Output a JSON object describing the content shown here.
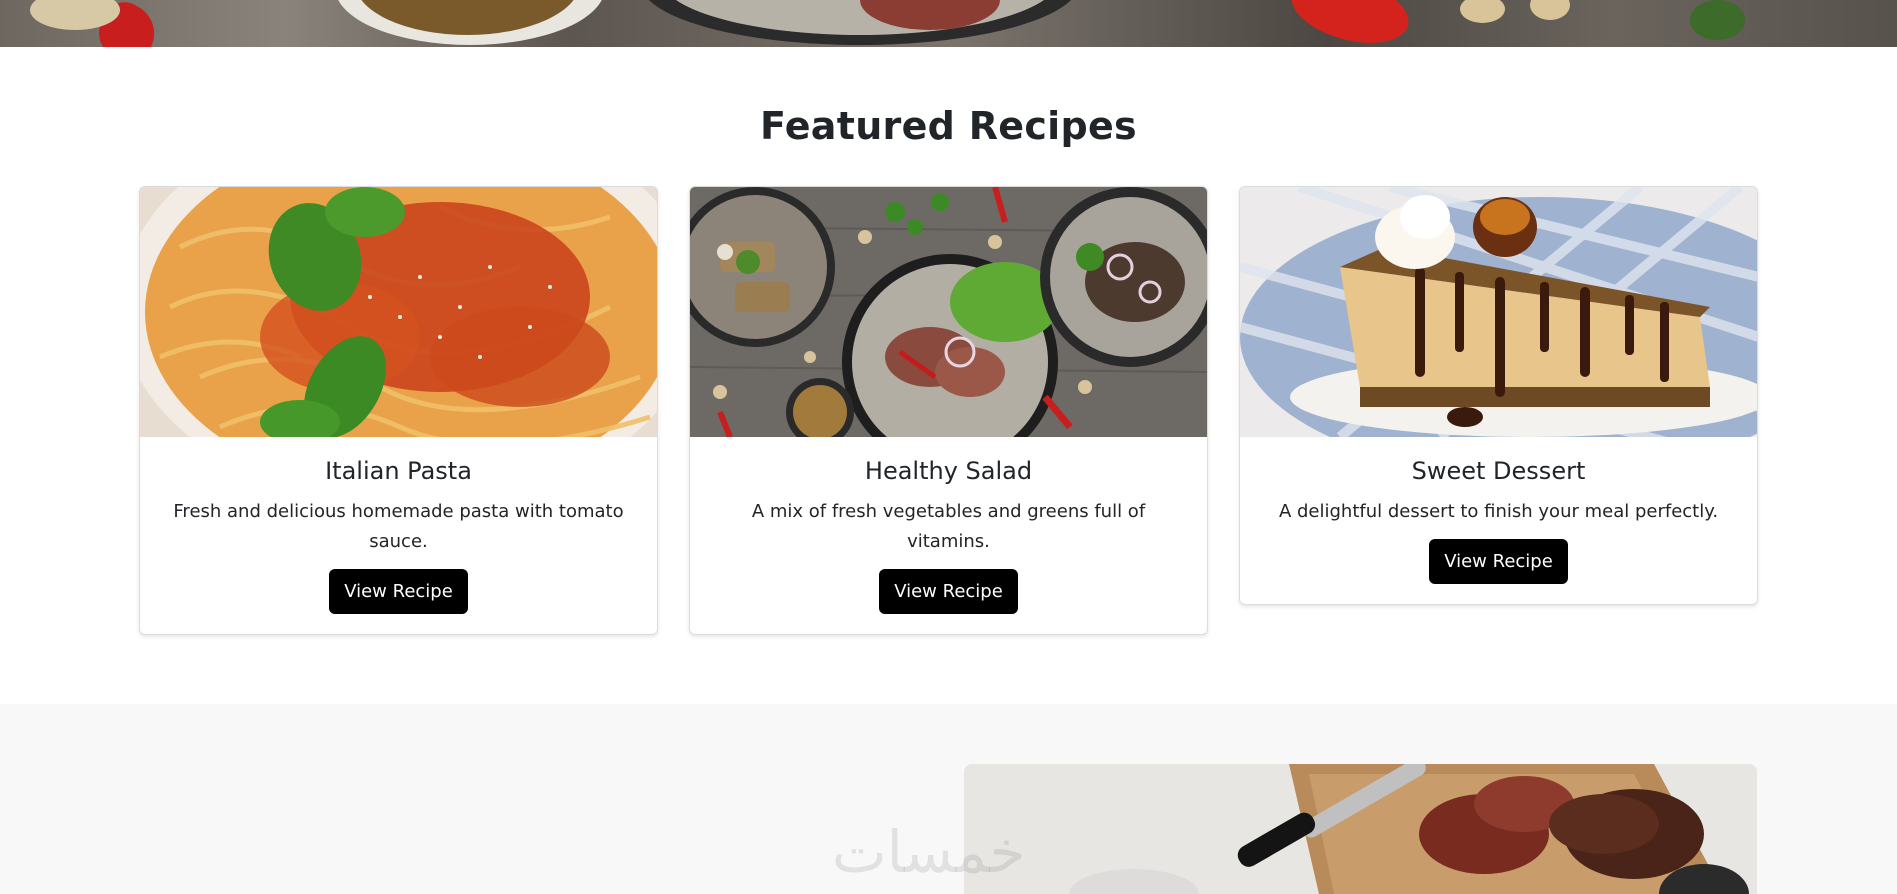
{
  "section": {
    "title": "Featured Recipes"
  },
  "cards": [
    {
      "title": "Italian Pasta",
      "description": "Fresh and delicious homemade pasta with tomato sauce.",
      "button": "View Recipe",
      "image_icon": "pasta-image"
    },
    {
      "title": "Healthy Salad",
      "description": "A mix of fresh vegetables and greens full of vitamins.",
      "button": "View Recipe",
      "image_icon": "salad-image"
    },
    {
      "title": "Sweet Dessert",
      "description": "A delightful dessert to finish your meal perfectly.",
      "button": "View Recipe",
      "image_icon": "dessert-image"
    }
  ],
  "watermark": "خمسات",
  "colors": {
    "button_bg": "#000000",
    "button_text": "#ffffff",
    "lower_section_bg": "#f8f8f8",
    "heading": "#212529"
  }
}
